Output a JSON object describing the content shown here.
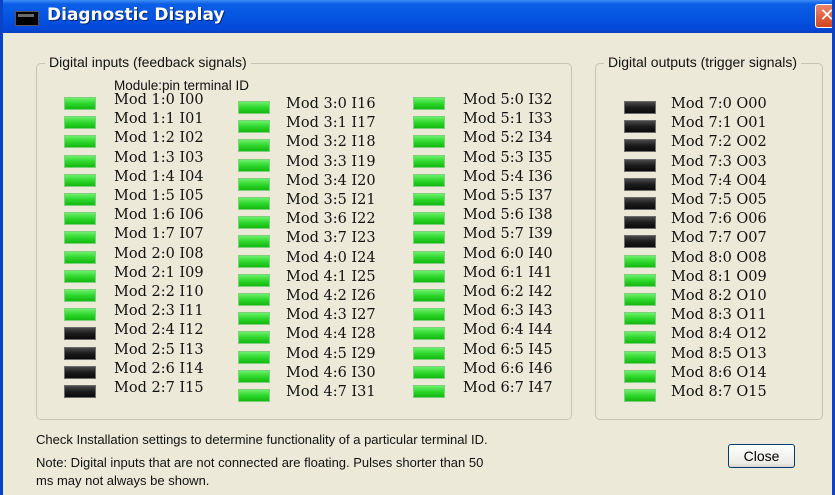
{
  "window": {
    "title": "Diagnostic Display",
    "close_symbol": "✕"
  },
  "inputs": {
    "group_title": "Digital inputs (feedback signals)",
    "column_header": "Module:pin terminal ID",
    "pins": [
      {
        "label": "Mod 1:0 I00",
        "on": true
      },
      {
        "label": "Mod 1:1 I01",
        "on": true
      },
      {
        "label": "Mod 1:2 I02",
        "on": true
      },
      {
        "label": "Mod 1:3 I03",
        "on": true
      },
      {
        "label": "Mod 1:4 I04",
        "on": true
      },
      {
        "label": "Mod 1:5 I05",
        "on": true
      },
      {
        "label": "Mod 1:6 I06",
        "on": true
      },
      {
        "label": "Mod 1:7 I07",
        "on": true
      },
      {
        "label": "Mod 2:0 I08",
        "on": true
      },
      {
        "label": "Mod 2:1 I09",
        "on": true
      },
      {
        "label": "Mod 2:2 I10",
        "on": true
      },
      {
        "label": "Mod 2:3 I11",
        "on": true
      },
      {
        "label": "Mod 2:4 I12",
        "on": false
      },
      {
        "label": "Mod 2:5 I13",
        "on": false
      },
      {
        "label": "Mod 2:6 I14",
        "on": false
      },
      {
        "label": "Mod 2:7 I15",
        "on": false
      },
      {
        "label": "Mod 3:0 I16",
        "on": true
      },
      {
        "label": "Mod 3:1 I17",
        "on": true
      },
      {
        "label": "Mod 3:2 I18",
        "on": true
      },
      {
        "label": "Mod 3:3 I19",
        "on": true
      },
      {
        "label": "Mod 3:4 I20",
        "on": true
      },
      {
        "label": "Mod 3:5 I21",
        "on": true
      },
      {
        "label": "Mod 3:6 I22",
        "on": true
      },
      {
        "label": "Mod 3:7 I23",
        "on": true
      },
      {
        "label": "Mod 4:0 I24",
        "on": true
      },
      {
        "label": "Mod 4:1 I25",
        "on": true
      },
      {
        "label": "Mod 4:2 I26",
        "on": true
      },
      {
        "label": "Mod 4:3 I27",
        "on": true
      },
      {
        "label": "Mod 4:4 I28",
        "on": true
      },
      {
        "label": "Mod 4:5 I29",
        "on": true
      },
      {
        "label": "Mod 4:6 I30",
        "on": true
      },
      {
        "label": "Mod 4:7 I31",
        "on": true
      },
      {
        "label": "Mod 5:0 I32",
        "on": true
      },
      {
        "label": "Mod 5:1 I33",
        "on": true
      },
      {
        "label": "Mod 5:2 I34",
        "on": true
      },
      {
        "label": "Mod 5:3 I35",
        "on": true
      },
      {
        "label": "Mod 5:4 I36",
        "on": true
      },
      {
        "label": "Mod 5:5 I37",
        "on": true
      },
      {
        "label": "Mod 5:6 I38",
        "on": true
      },
      {
        "label": "Mod 5:7 I39",
        "on": true
      },
      {
        "label": "Mod 6:0 I40",
        "on": true
      },
      {
        "label": "Mod 6:1 I41",
        "on": true
      },
      {
        "label": "Mod 6:2 I42",
        "on": true
      },
      {
        "label": "Mod 6:3 I43",
        "on": true
      },
      {
        "label": "Mod 6:4 I44",
        "on": true
      },
      {
        "label": "Mod 6:5 I45",
        "on": true
      },
      {
        "label": "Mod 6:6 I46",
        "on": true
      },
      {
        "label": "Mod 6:7 I47",
        "on": true
      }
    ]
  },
  "outputs": {
    "group_title": "Digital outputs (trigger signals)",
    "pins": [
      {
        "label": "Mod 7:0 O00",
        "on": false
      },
      {
        "label": "Mod 7:1 O01",
        "on": false
      },
      {
        "label": "Mod 7:2 O02",
        "on": false
      },
      {
        "label": "Mod 7:3 O03",
        "on": false
      },
      {
        "label": "Mod 7:4 O04",
        "on": false
      },
      {
        "label": "Mod 7:5 O05",
        "on": false
      },
      {
        "label": "Mod 7:6 O06",
        "on": false
      },
      {
        "label": "Mod 7:7 O07",
        "on": false
      },
      {
        "label": "Mod 8:0 O08",
        "on": true
      },
      {
        "label": "Mod 8:1 O09",
        "on": true
      },
      {
        "label": "Mod 8:2 O10",
        "on": true
      },
      {
        "label": "Mod 8:3 O11",
        "on": true
      },
      {
        "label": "Mod 8:4 O12",
        "on": true
      },
      {
        "label": "Mod 8:5 O13",
        "on": true
      },
      {
        "label": "Mod 8:6 O14",
        "on": true
      },
      {
        "label": "Mod 8:7 O15",
        "on": true
      }
    ]
  },
  "notes": {
    "line1": "Check Installation settings to determine functionality of a particular terminal ID.",
    "line2": "Note: Digital inputs that are not connected are floating. Pulses shorter than 50",
    "line3": "ms may not always be shown."
  },
  "buttons": {
    "close_label": "Close"
  },
  "colors": {
    "led_on": "#2ed82c",
    "led_off": "#1b1b1b",
    "titlebar": "#0554e3",
    "window_bg": "#ece9d8"
  }
}
